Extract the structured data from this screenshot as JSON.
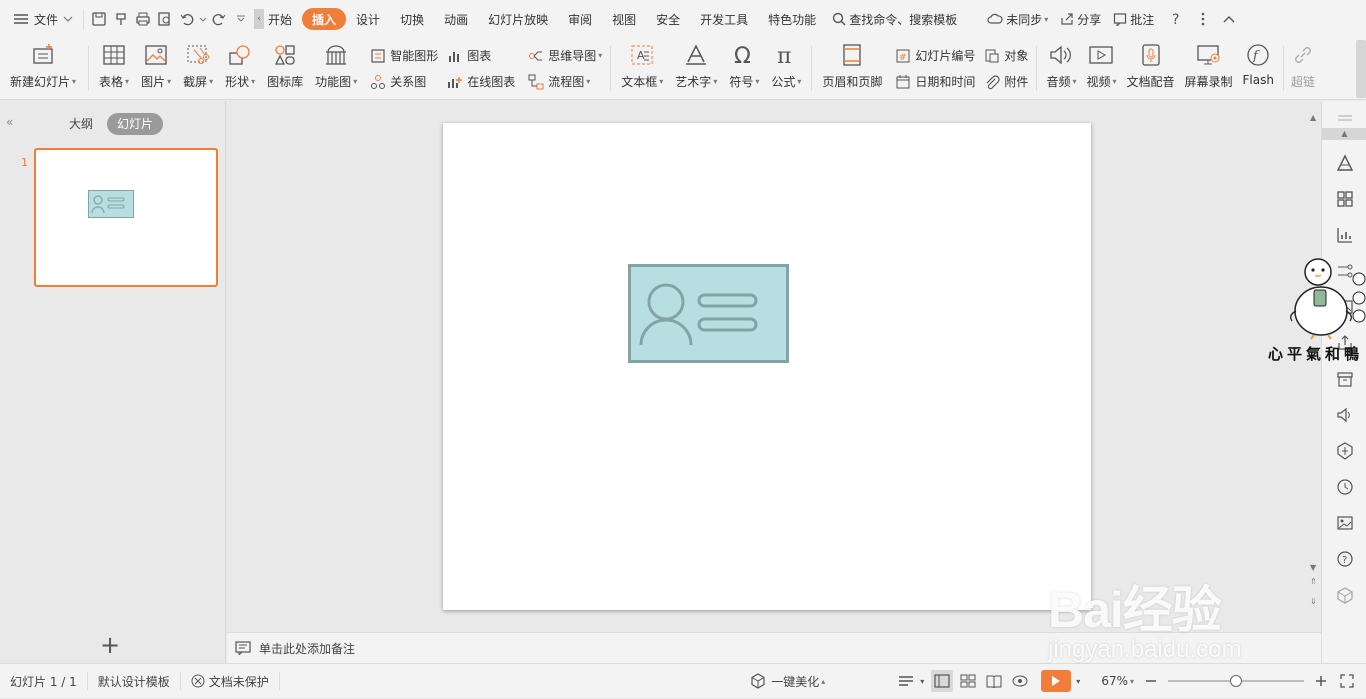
{
  "menubar": {
    "file_label": "文件",
    "tabs": [
      "开始",
      "插入",
      "设计",
      "切换",
      "动画",
      "幻灯片放映",
      "审阅",
      "视图",
      "安全",
      "开发工具",
      "特色功能"
    ],
    "active_tab": "插入",
    "search_label": "查找命令、搜索模板",
    "sync_label": "未同步",
    "share_label": "分享",
    "comment_label": "批注"
  },
  "ribbon": {
    "new_slide": "新建幻灯片",
    "table": "表格",
    "picture": "图片",
    "screenshot": "截屏",
    "shape": "形状",
    "icon_lib": "图标库",
    "func_chart": "功能图",
    "smart_shape": "智能图形",
    "chart": "图表",
    "relation": "关系图",
    "online_chart": "在线图表",
    "mindmap": "思维导图",
    "flowchart": "流程图",
    "textbox": "文本框",
    "wordart": "艺术字",
    "symbol": "符号",
    "formula": "公式",
    "header_footer": "页眉和页脚",
    "slide_number": "幻灯片编号",
    "object": "对象",
    "datetime": "日期和时间",
    "attachment": "附件",
    "audio": "音频",
    "video": "视频",
    "doc_voice": "文档配音",
    "screen_record": "屏幕录制",
    "flash": "Flash",
    "hyperlink": "超链"
  },
  "leftpanel": {
    "tab_outline": "大纲",
    "tab_slides": "幻灯片",
    "slide_number": "1"
  },
  "notes": {
    "placeholder": "单击此处添加备注"
  },
  "statusbar": {
    "slide_info": "幻灯片 1 / 1",
    "template": "默认设计模板",
    "protect": "文档未保护",
    "beautify": "一键美化",
    "zoom": "67%",
    "zoom_fraction": 0.5
  },
  "watermark": {
    "brand": "Bai经验",
    "url": "jingyan.baidu.com",
    "duck_text": "心平氣和鴨"
  },
  "colors": {
    "accent": "#f07e3a",
    "card_fill": "#b7dfe1",
    "card_stroke": "#84a3a4"
  }
}
